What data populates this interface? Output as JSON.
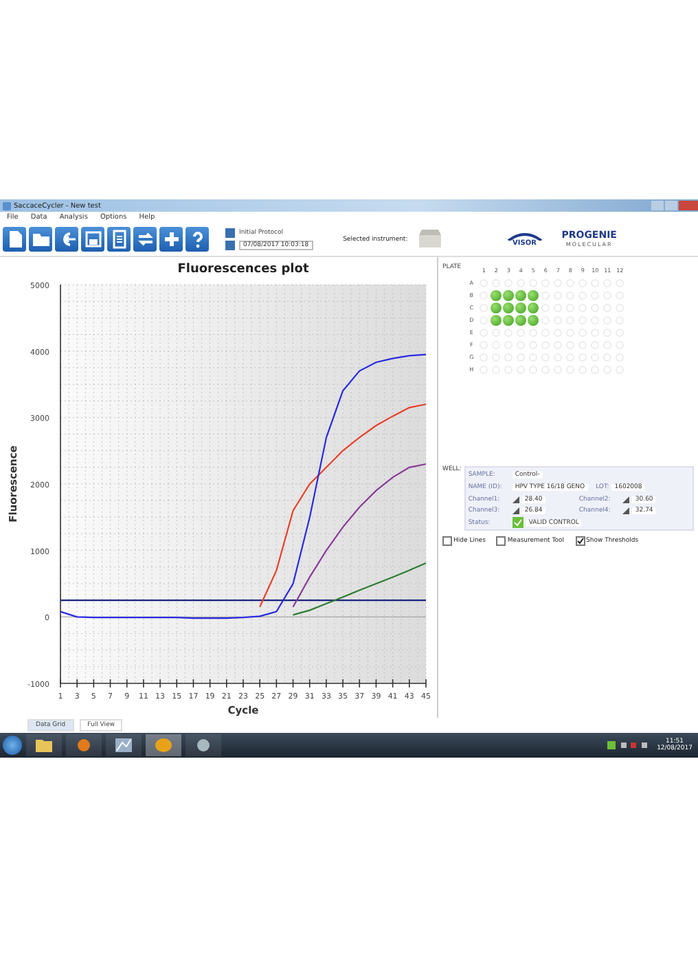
{
  "window": {
    "title": "SaccaceCycler - New test"
  },
  "menu": [
    "File",
    "Data",
    "Analysis",
    "Options",
    "Help"
  ],
  "toolbar": {
    "protocol": "Initial Protocol",
    "datetime": "07/08/2017 10:03:18",
    "instrument_label": "Selected instrument:",
    "logo_left": "VISOR",
    "logo_right": "PROGENIE",
    "logo_right_sub": "MOLECULAR"
  },
  "chart": {
    "chart_data": {
      "type": "line",
      "title": "Fluorescences plot",
      "xlabel": "Cycle",
      "ylabel": "Fluorescence",
      "x": [
        1,
        3,
        5,
        7,
        9,
        11,
        13,
        15,
        17,
        19,
        21,
        23,
        25,
        27,
        29,
        31,
        33,
        35,
        37,
        39,
        41,
        43,
        45
      ],
      "series": [
        {
          "color": "#e8402a",
          "values": [
            null,
            null,
            null,
            null,
            null,
            null,
            null,
            null,
            null,
            null,
            null,
            null,
            150,
            700,
            1600,
            2000,
            2250,
            2500,
            2700,
            2880,
            3020,
            3150,
            3200
          ]
        },
        {
          "color": "#2a2ae0",
          "values": [
            80,
            0,
            -10,
            -10,
            -10,
            -10,
            -10,
            -10,
            -20,
            -20,
            -20,
            -10,
            10,
            80,
            500,
            1500,
            2700,
            3400,
            3700,
            3830,
            3890,
            3930,
            3950
          ]
        },
        {
          "color": "#8a3a9a",
          "values": [
            null,
            null,
            null,
            null,
            null,
            null,
            null,
            null,
            null,
            null,
            null,
            null,
            null,
            null,
            150,
            600,
            1000,
            1350,
            1650,
            1900,
            2100,
            2250,
            2300
          ]
        },
        {
          "color": "#2e7d32",
          "values": [
            null,
            null,
            null,
            null,
            null,
            null,
            null,
            null,
            null,
            null,
            null,
            null,
            null,
            null,
            30,
            100,
            200,
            300,
            400,
            500,
            600,
            700,
            810
          ]
        }
      ],
      "grid": true,
      "xlim": [
        1,
        45
      ],
      "ylim": [
        -1000,
        5000
      ],
      "xticks": [
        1,
        3,
        5,
        7,
        9,
        11,
        13,
        15,
        17,
        19,
        21,
        23,
        25,
        27,
        29,
        31,
        33,
        35,
        37,
        39,
        41,
        43,
        45
      ],
      "yticks": [
        -1000,
        0,
        1000,
        2000,
        3000,
        4000,
        5000
      ],
      "ref_lines": [
        {
          "axis": "y",
          "value": 250
        }
      ]
    }
  },
  "plate": {
    "label": "PLATE",
    "columns": [
      "1",
      "2",
      "3",
      "4",
      "5",
      "6",
      "7",
      "8",
      "9",
      "10",
      "11",
      "12"
    ],
    "rows": [
      {
        "label": "A",
        "filled": [
          false,
          false,
          false,
          false,
          false,
          false,
          false,
          false,
          false,
          false,
          false,
          false
        ]
      },
      {
        "label": "B",
        "filled": [
          false,
          true,
          true,
          true,
          true,
          false,
          false,
          false,
          false,
          false,
          false,
          false
        ]
      },
      {
        "label": "C",
        "filled": [
          false,
          true,
          true,
          true,
          true,
          false,
          false,
          false,
          false,
          false,
          false,
          false
        ]
      },
      {
        "label": "D",
        "filled": [
          false,
          true,
          true,
          true,
          true,
          false,
          false,
          false,
          false,
          false,
          false,
          false
        ]
      },
      {
        "label": "E",
        "filled": [
          false,
          false,
          false,
          false,
          false,
          false,
          false,
          false,
          false,
          false,
          false,
          false
        ]
      },
      {
        "label": "F",
        "filled": [
          false,
          false,
          false,
          false,
          false,
          false,
          false,
          false,
          false,
          false,
          false,
          false
        ]
      },
      {
        "label": "G",
        "filled": [
          false,
          false,
          false,
          false,
          false,
          false,
          false,
          false,
          false,
          false,
          false,
          false
        ]
      },
      {
        "label": "H",
        "filled": [
          false,
          false,
          false,
          false,
          false,
          false,
          false,
          false,
          false,
          false,
          false,
          false
        ]
      }
    ]
  },
  "well": {
    "label": "WELL:",
    "sample_label": "SAMPLE:",
    "sample": "Control-",
    "name_label": "NAME (ID):",
    "name": "HPV TYPE 16/18 GENO",
    "lot_label": "LOT:",
    "lot": "1602008",
    "channels": [
      {
        "label": "Channel1:",
        "value": "28.40"
      },
      {
        "label": "Channel2:",
        "value": "30.60"
      },
      {
        "label": "Channel3:",
        "value": "26.84"
      },
      {
        "label": "Channel4:",
        "value": "32.74"
      }
    ],
    "status_label": "Status:",
    "status_ok": true,
    "status": "VALID CONTROL"
  },
  "options": [
    {
      "label": "Hide Lines",
      "checked": false
    },
    {
      "label": "Measurement Tool",
      "checked": false
    },
    {
      "label": "Show Thresholds",
      "checked": true
    }
  ],
  "tabs": [
    {
      "label": "Data Grid",
      "selected": true
    },
    {
      "label": "Full View",
      "selected": false
    }
  ],
  "taskbar": {
    "time": "11:51",
    "date": "12/08/2017"
  }
}
